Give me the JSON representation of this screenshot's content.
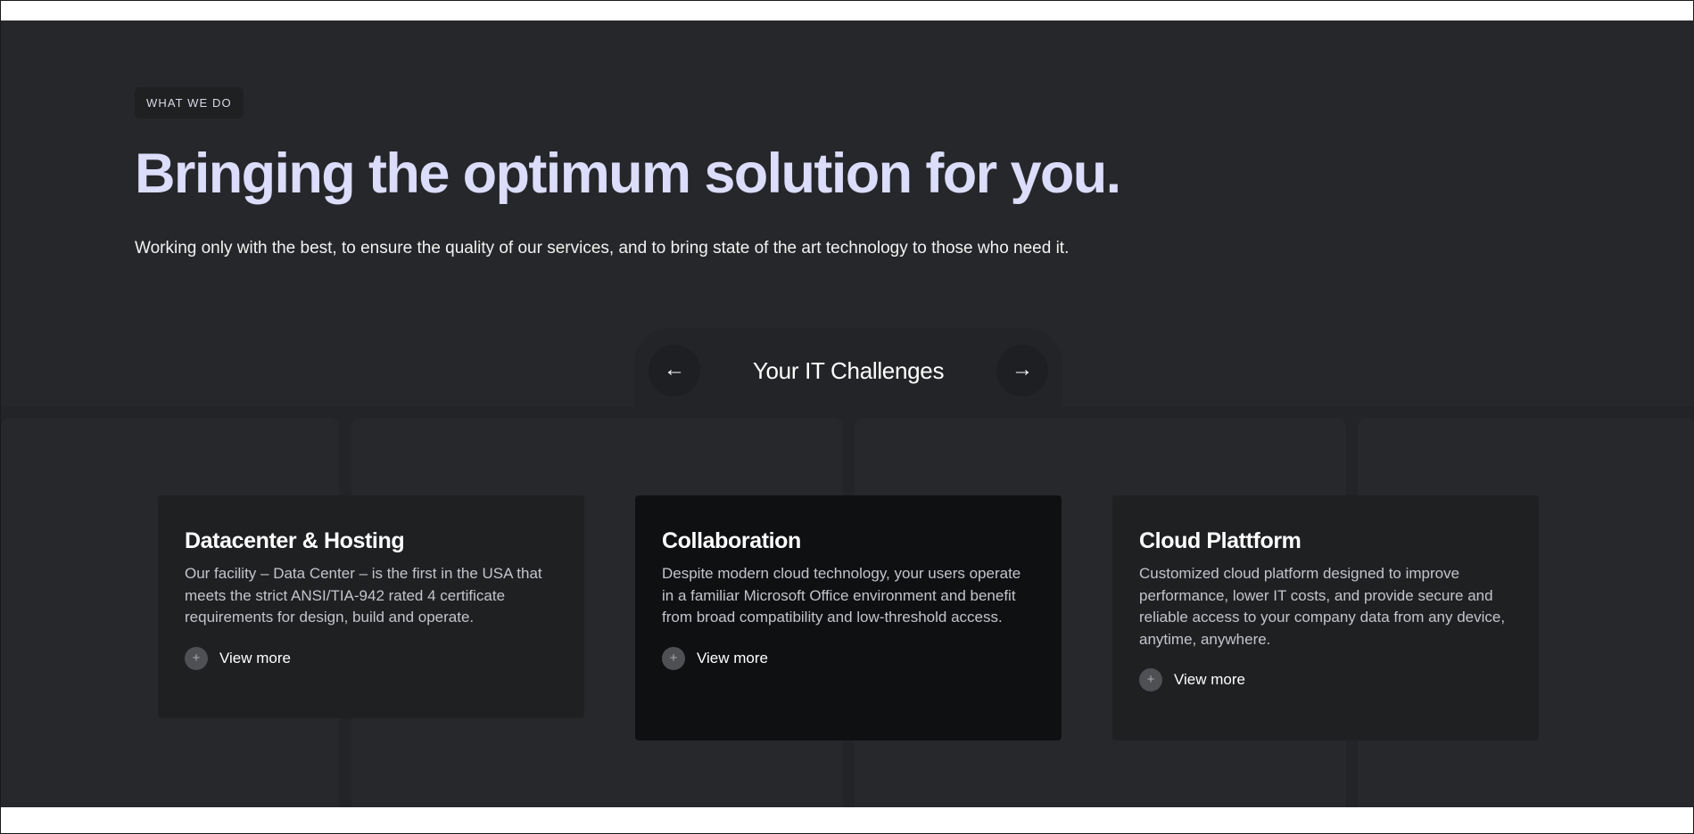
{
  "section": {
    "eyebrow": "WHAT WE DO",
    "headline": "Bringing the optimum solution for you.",
    "lede": "Working only with the best, to ensure the quality of our services, and to bring state of the art technology to those who need it."
  },
  "tabs": {
    "current_title": "Your IT Challenges",
    "prev_icon": "←",
    "next_icon": "→"
  },
  "cards": [
    {
      "title": "Datacenter & Hosting",
      "body": "Our facility – Data Center – is the first in the USA that meets the strict ANSI/TIA-942 rated 4 certificate requirements for design, build and operate.",
      "cta": "View more",
      "icon": "+"
    },
    {
      "title": "Collaboration",
      "body": "Despite modern cloud technology, your users operate in a familiar Microsoft Office environment and benefit from broad compatibility and low-threshold access.",
      "cta": "View more",
      "icon": "+"
    },
    {
      "title": "Cloud Plattform",
      "body": "Customized cloud platform designed to improve performance, lower IT costs, and provide secure and reliable access to your company data from any device, anytime, anywhere.",
      "cta": "View more",
      "icon": "+"
    }
  ],
  "colors": {
    "section_bg": "#26272a",
    "headline": "#dcdcfb",
    "highlight_card": "#0f1012",
    "card": "#1f2022"
  }
}
